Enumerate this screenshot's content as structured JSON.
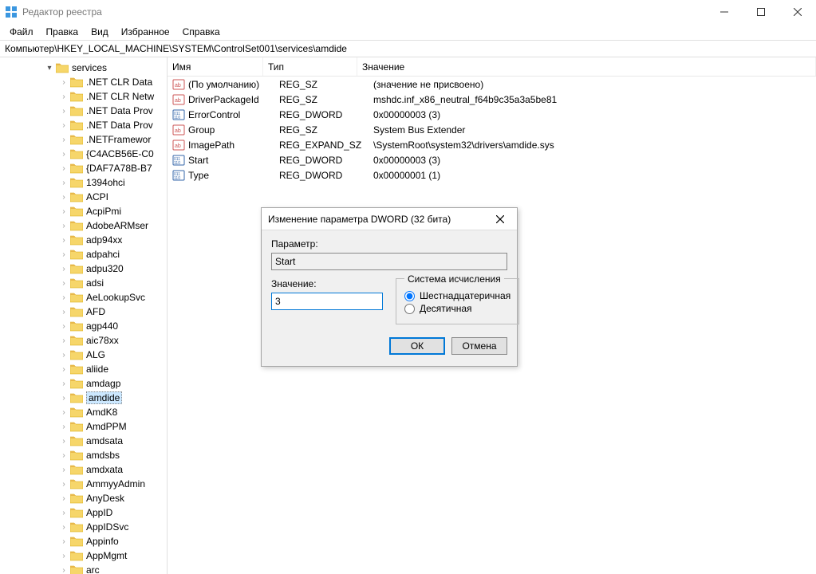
{
  "window": {
    "title": "Редактор реестра"
  },
  "menu": {
    "file": "Файл",
    "edit": "Правка",
    "view": "Вид",
    "favorites": "Избранное",
    "help": "Справка"
  },
  "address": "Компьютер\\HKEY_LOCAL_MACHINE\\SYSTEM\\ControlSet001\\services\\amdide",
  "tree": {
    "parent": "services",
    "items": [
      ".NET CLR Data",
      ".NET CLR Netw",
      ".NET Data Prov",
      ".NET Data Prov",
      ".NETFramewor",
      "{C4ACB56E-C0",
      "{DAF7A78B-B7",
      "1394ohci",
      "ACPI",
      "AcpiPmi",
      "AdobeARMser",
      "adp94xx",
      "adpahci",
      "adpu320",
      "adsi",
      "AeLookupSvc",
      "AFD",
      "agp440",
      "aic78xx",
      "ALG",
      "aliide",
      "amdagp",
      "amdide",
      "AmdK8",
      "AmdPPM",
      "amdsata",
      "amdsbs",
      "amdxata",
      "AmmyyAdmin",
      "AnyDesk",
      "AppID",
      "AppIDSvc",
      "Appinfo",
      "AppMgmt",
      "arc"
    ],
    "selected_index": 22
  },
  "list": {
    "headers": {
      "name": "Имя",
      "type": "Тип",
      "value": "Значение"
    },
    "rows": [
      {
        "icon": "sz",
        "name": "(По умолчанию)",
        "type": "REG_SZ",
        "value": "(значение не присвоено)"
      },
      {
        "icon": "sz",
        "name": "DriverPackageId",
        "type": "REG_SZ",
        "value": "mshdc.inf_x86_neutral_f64b9c35a3a5be81"
      },
      {
        "icon": "bin",
        "name": "ErrorControl",
        "type": "REG_DWORD",
        "value": "0x00000003 (3)"
      },
      {
        "icon": "sz",
        "name": "Group",
        "type": "REG_SZ",
        "value": "System Bus Extender"
      },
      {
        "icon": "sz",
        "name": "ImagePath",
        "type": "REG_EXPAND_SZ",
        "value": "\\SystemRoot\\system32\\drivers\\amdide.sys"
      },
      {
        "icon": "bin",
        "name": "Start",
        "type": "REG_DWORD",
        "value": "0x00000003 (3)"
      },
      {
        "icon": "bin",
        "name": "Type",
        "type": "REG_DWORD",
        "value": "0x00000001 (1)"
      }
    ]
  },
  "dialog": {
    "title": "Изменение параметра DWORD (32 бита)",
    "param_label": "Параметр:",
    "param_value": "Start",
    "value_label": "Значение:",
    "value_value": "3",
    "radix_label": "Система исчисления",
    "radix_hex": "Шестнадцатеричная",
    "radix_dec": "Десятичная",
    "ok": "ОК",
    "cancel": "Отмена"
  }
}
